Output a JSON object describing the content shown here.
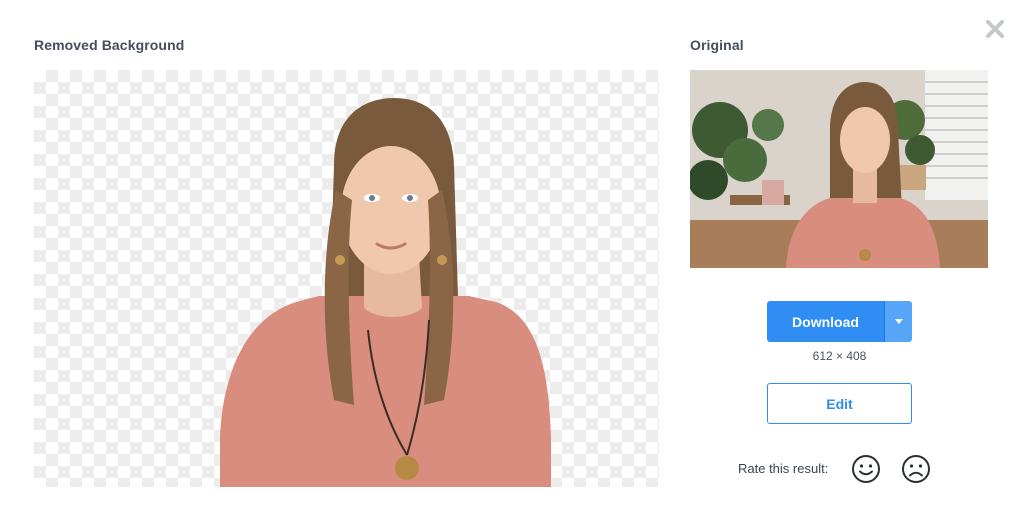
{
  "modal": {
    "removed_title": "Removed Background",
    "original_title": "Original",
    "close_icon": "close-icon"
  },
  "actions": {
    "download_label": "Download",
    "download_menu_icon": "caret-down-icon",
    "dimensions": "612 × 408",
    "edit_label": "Edit"
  },
  "rating": {
    "label": "Rate this result:",
    "positive_icon": "smiley-face-icon",
    "negative_icon": "frowning-face-icon"
  },
  "colors": {
    "accent": "#2f8df4",
    "heading": "#454e5c"
  }
}
